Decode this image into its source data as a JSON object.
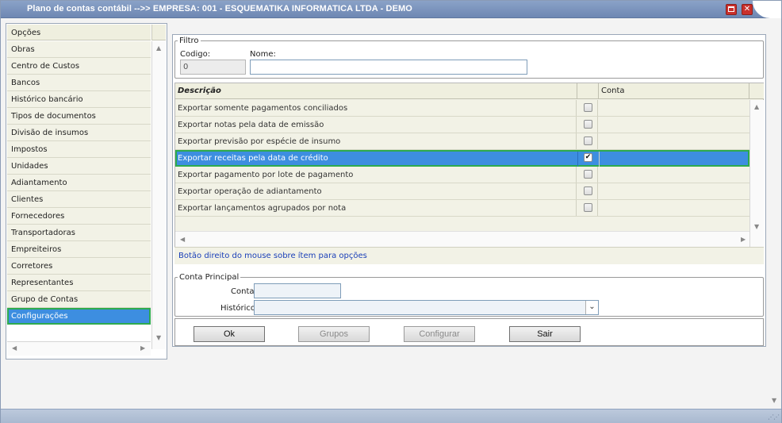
{
  "window": {
    "title": "Plano de contas contábil -->> EMPRESA: 001 - ESQUEMATIKA INFORMATICA LTDA - DEMO"
  },
  "options": {
    "header": "Opções",
    "items": [
      "Obras",
      "Centro de Custos",
      "Bancos",
      "Histórico bancário",
      "Tipos de documentos",
      "Divisão de insumos",
      "Impostos",
      "Unidades",
      "Adiantamento",
      "Clientes",
      "Fornecedores",
      "Transportadoras",
      "Empreiteiros",
      "Corretores",
      "Representantes",
      "Grupo de Contas",
      "Configurações"
    ],
    "selected": "Configurações"
  },
  "filtro": {
    "legend": "Filtro",
    "codigo_label": "Codigo:",
    "codigo_value": "0",
    "nome_label": "Nome:",
    "nome_value": ""
  },
  "grid": {
    "columns": [
      "Descrição",
      "",
      "Conta"
    ],
    "rows": [
      {
        "descricao": "Exportar somente pagamentos conciliados",
        "checked": false,
        "conta": ""
      },
      {
        "descricao": "Exportar notas pela data de emissão",
        "checked": false,
        "conta": ""
      },
      {
        "descricao": "Exportar previsão por espécie de insumo",
        "checked": false,
        "conta": ""
      },
      {
        "descricao": "Exportar receitas pela data de crédito",
        "checked": true,
        "conta": ""
      },
      {
        "descricao": "Exportar pagamento por lote de pagamento",
        "checked": false,
        "conta": ""
      },
      {
        "descricao": "Exportar operação de adiantamento",
        "checked": false,
        "conta": ""
      },
      {
        "descricao": "Exportar lançamentos agrupados por nota",
        "checked": false,
        "conta": ""
      }
    ],
    "selected_row": 3,
    "hint": "Botão direito do mouse sobre ítem para opções"
  },
  "conta_principal": {
    "legend": "Conta Principal",
    "conta_label": "Conta:",
    "conta_value": "",
    "historico_label": "Histórico:",
    "historico_value": ""
  },
  "buttons": {
    "ok": "Ok",
    "grupos": "Grupos",
    "configurar": "Configurar",
    "sair": "Sair"
  },
  "colors": {
    "selection": "#3d8ee0",
    "selection_outline": "#2eaa4e",
    "title_bar": "#7d96c0",
    "hint_text": "#1a3fb8"
  }
}
